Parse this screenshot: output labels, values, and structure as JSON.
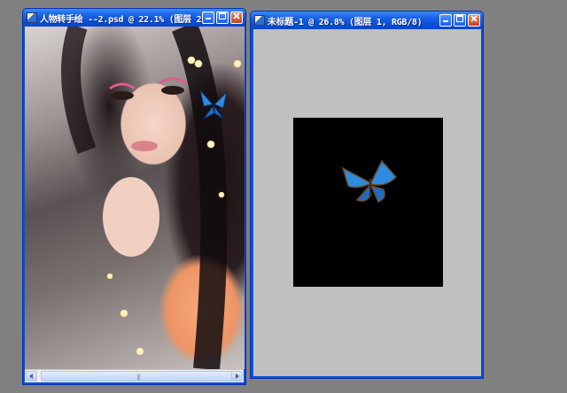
{
  "windows": [
    {
      "title": "人物转手绘 --2.psd @ 22.1% (图层 2...",
      "buttons": {
        "minimize": "minimize",
        "maximize": "maximize",
        "close": "close"
      }
    },
    {
      "title": "未标题-1 @ 26.8% (图层 1, RGB/8)",
      "buttons": {
        "minimize": "minimize",
        "maximize": "maximize",
        "close": "close"
      }
    }
  ],
  "icons": {
    "app": "photoshop-document-icon",
    "minimize": "minimize-icon",
    "maximize": "maximize-icon",
    "close": "close-icon",
    "scroll_left": "arrow-left-icon",
    "scroll_right": "arrow-right-icon",
    "grip": "grip-icon"
  },
  "colors": {
    "workspace": "#808080",
    "titlebar": "#0a4fd6",
    "canvas_gray": "#c0c0c0",
    "butterfly_blue": "#2f8be0"
  }
}
